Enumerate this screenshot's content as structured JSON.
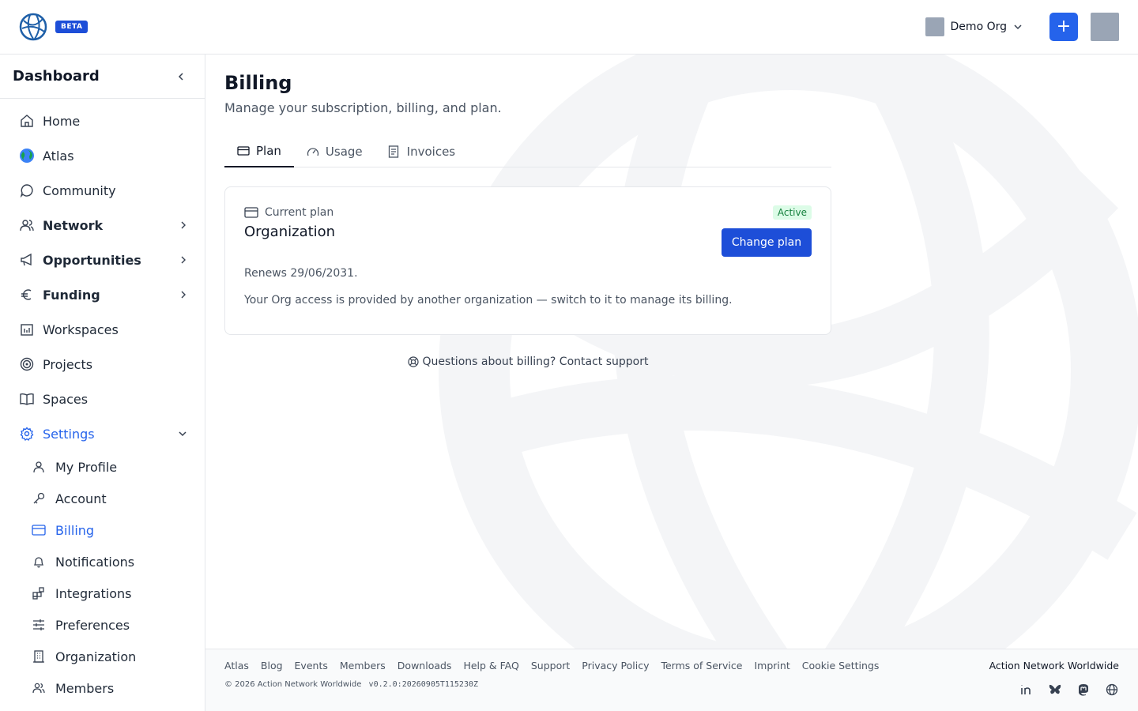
{
  "header": {
    "beta_label": "BETA",
    "org_name": "Demo Org",
    "add_label": "+"
  },
  "sidebar": {
    "title": "Dashboard",
    "items": [
      {
        "label": "Home",
        "icon": "home-icon"
      },
      {
        "label": "Atlas",
        "icon": "globe-emoji-icon"
      },
      {
        "label": "Community",
        "icon": "chat-bubble-icon"
      },
      {
        "label": "Network",
        "icon": "users-icon"
      },
      {
        "label": "Opportunities",
        "icon": "megaphone-icon"
      },
      {
        "label": "Funding",
        "icon": "euro-icon"
      },
      {
        "label": "Workspaces",
        "icon": "calendar-icon"
      },
      {
        "label": "Projects",
        "icon": "target-icon"
      },
      {
        "label": "Spaces",
        "icon": "book-icon"
      },
      {
        "label": "Settings",
        "icon": "gear-icon"
      }
    ],
    "settings_items": [
      {
        "label": "My Profile",
        "icon": "user-icon"
      },
      {
        "label": "Account",
        "icon": "key-icon"
      },
      {
        "label": "Billing",
        "icon": "credit-card-icon"
      },
      {
        "label": "Notifications",
        "icon": "bell-icon"
      },
      {
        "label": "Integrations",
        "icon": "blocks-icon"
      },
      {
        "label": "Preferences",
        "icon": "sliders-icon"
      },
      {
        "label": "Organization",
        "icon": "building-icon"
      },
      {
        "label": "Members",
        "icon": "users-icon"
      }
    ]
  },
  "page": {
    "title": "Billing",
    "subtitle": "Manage your subscription, billing, and plan.",
    "tabs": [
      {
        "label": "Plan",
        "active": true
      },
      {
        "label": "Usage",
        "active": false
      },
      {
        "label": "Invoices",
        "active": false
      }
    ],
    "card": {
      "label": "Current plan",
      "plan_name": "Organization",
      "status": "Active",
      "change_button": "Change plan",
      "renews": "Renews 29/06/2031.",
      "note": "Your Org access is provided by another organization — switch to it to manage its billing."
    },
    "support_text": "Questions about billing? Contact support"
  },
  "footer": {
    "links": [
      "Atlas",
      "Blog",
      "Events",
      "Members",
      "Downloads",
      "Help & FAQ",
      "Support",
      "Privacy Policy",
      "Terms of Service",
      "Imprint",
      "Cookie Settings"
    ],
    "copyright": "© 2026 Action Network Worldwide",
    "version": "v0.2.0:20260905T115230Z",
    "brand": "Action Network Worldwide",
    "socials": [
      "linkedin-icon",
      "bluesky-icon",
      "mastodon-icon",
      "globe-icon"
    ]
  },
  "colors": {
    "accent": "#2563eb",
    "active_badge_bg": "#dcfce7",
    "active_badge_text": "#15803d"
  }
}
